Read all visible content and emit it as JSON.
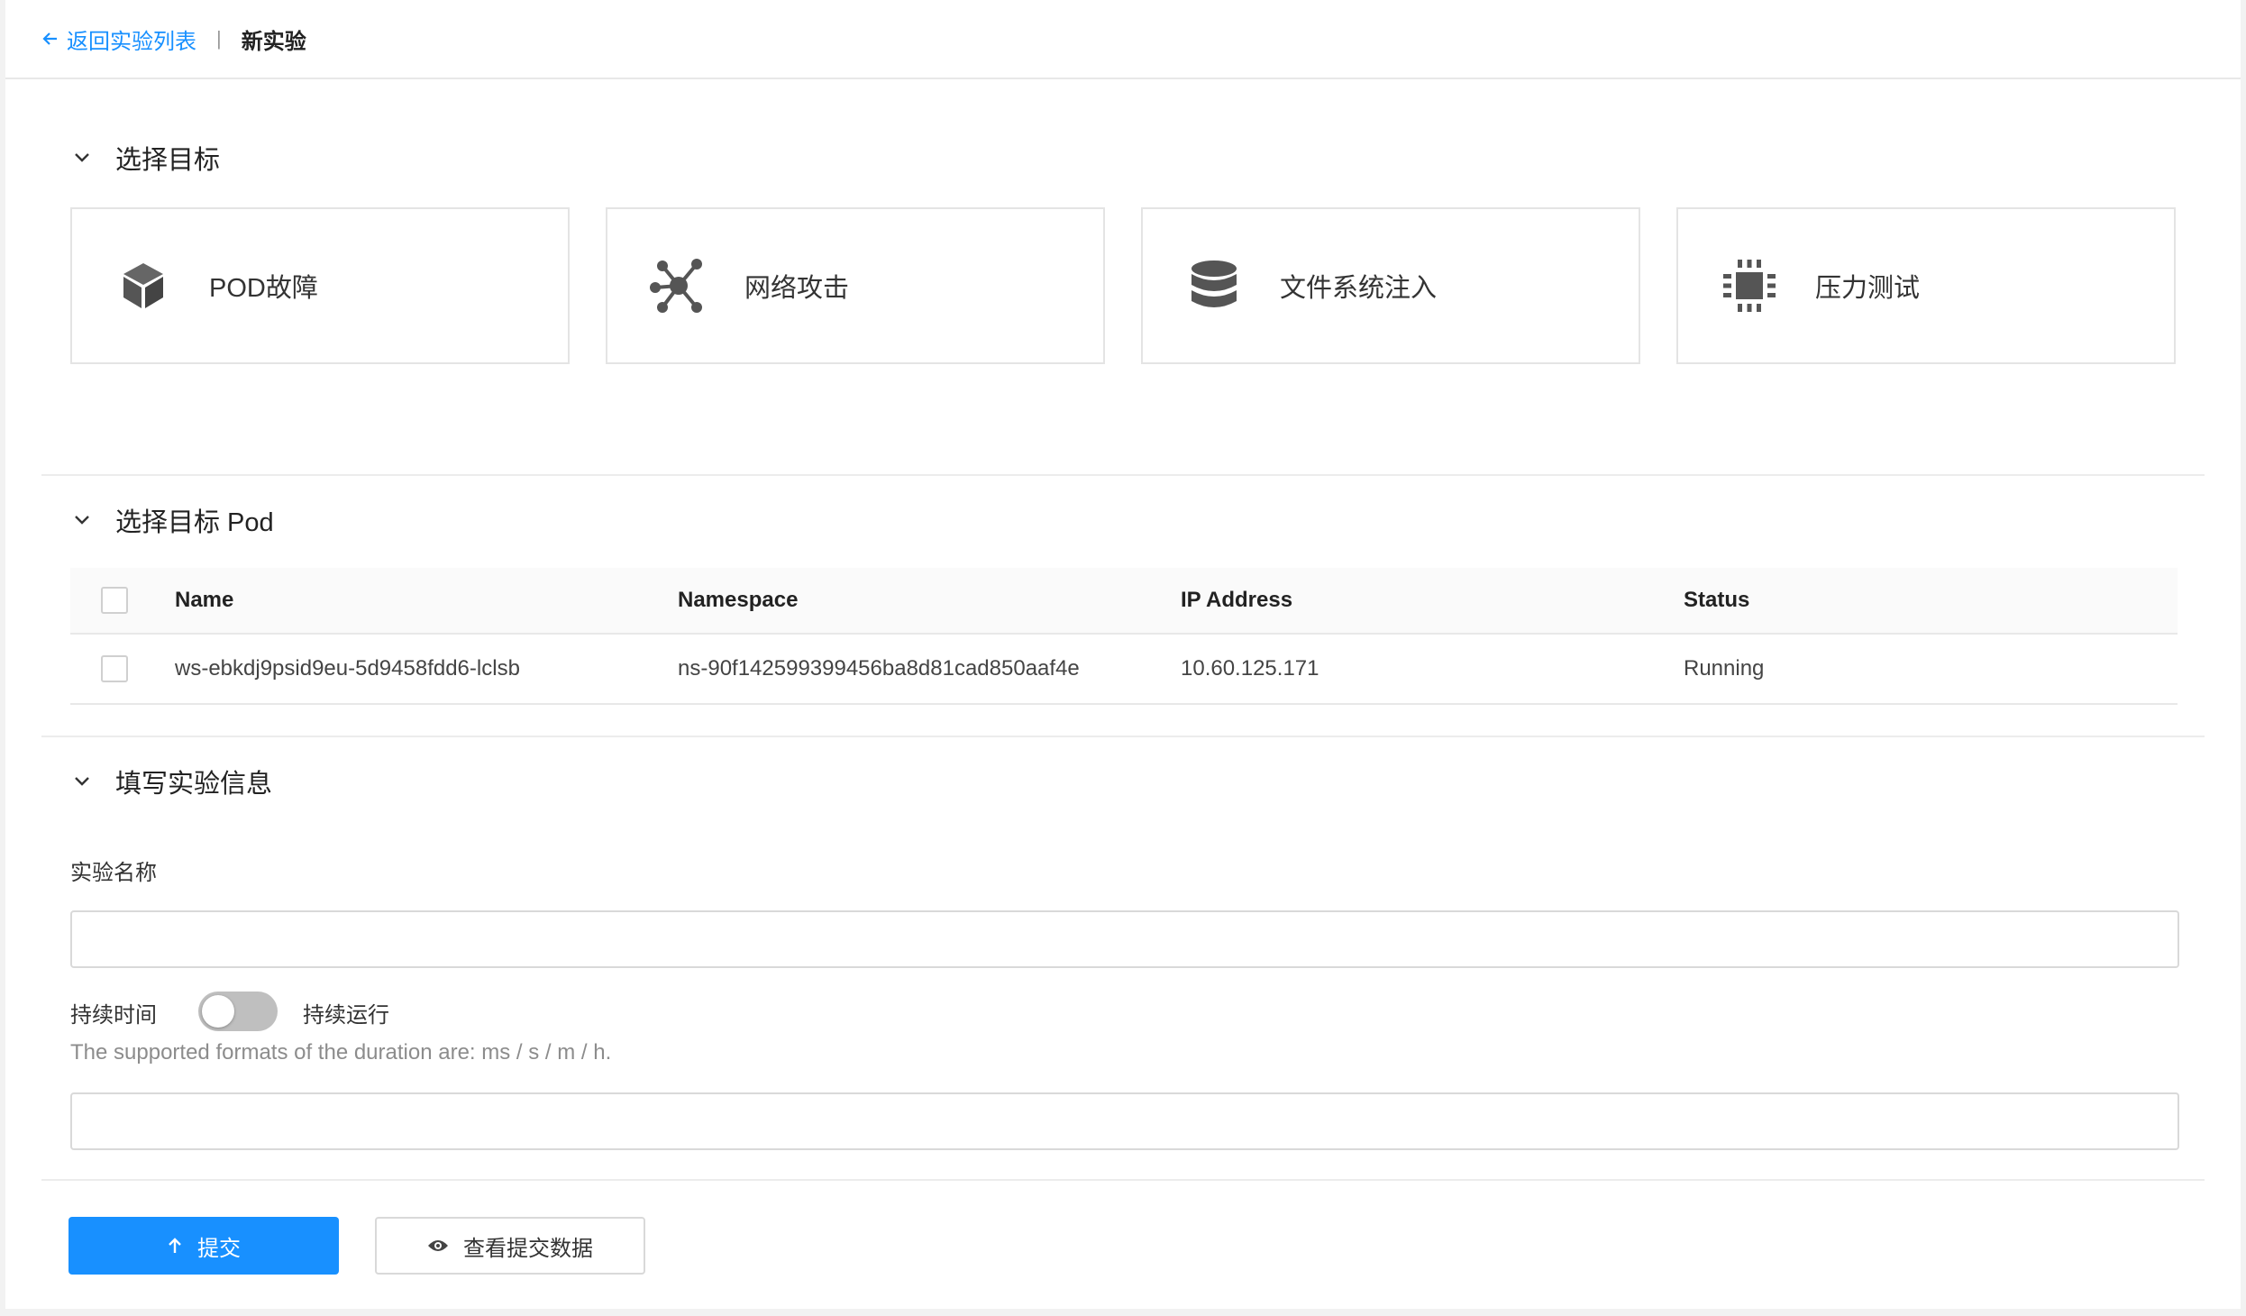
{
  "header": {
    "back_label": "返回实验列表",
    "current": "新实验"
  },
  "sections": {
    "target": "选择目标",
    "target_pod": "选择目标 Pod",
    "info": "填写实验信息"
  },
  "targets": [
    {
      "label": "POD故障",
      "icon": "cube-icon"
    },
    {
      "label": "网络攻击",
      "icon": "network-hub-icon"
    },
    {
      "label": "文件系统注入",
      "icon": "database-icon"
    },
    {
      "label": "压力测试",
      "icon": "cpu-chip-icon"
    }
  ],
  "table": {
    "headers": [
      "Name",
      "Namespace",
      "IP Address",
      "Status"
    ],
    "rows": [
      {
        "name": "ws-ebkdj9psid9eu-5d9458fdd6-lclsb",
        "namespace": "ns-90f142599399456ba8d81cad850aaf4e",
        "ip": "10.60.125.171",
        "status": "Running"
      }
    ]
  },
  "form": {
    "name_label": "实验名称",
    "name_value": "",
    "duration_label": "持续时间",
    "continuous_label": "持续运行",
    "continuous_on": false,
    "duration_hint": "The supported formats of the duration are: ms / s / m / h.",
    "duration_value": ""
  },
  "buttons": {
    "submit": "提交",
    "preview": "查看提交数据"
  },
  "colors": {
    "accent": "#1890ff",
    "icon": "#555555",
    "border": "#d9d9d9"
  }
}
